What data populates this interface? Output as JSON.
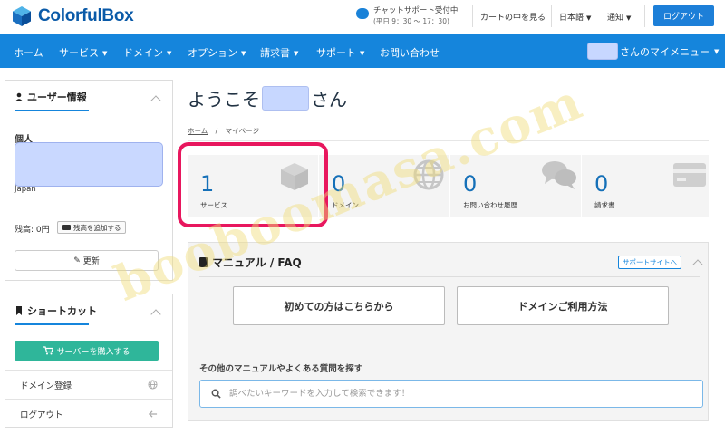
{
  "header": {
    "brand": "ColorfulBox",
    "chat_support": "チャットサポート受付中",
    "chat_hours": "(平日 9：30 ～ 17：30)",
    "cart_link": "カートの中を見る",
    "language": "日本語",
    "notifications": "通知",
    "logout_button": "ログアウト"
  },
  "nav": {
    "items": [
      {
        "label": "ホーム",
        "has_caret": false
      },
      {
        "label": "サービス",
        "has_caret": true
      },
      {
        "label": "ドメイン",
        "has_caret": true
      },
      {
        "label": "オプション",
        "has_caret": true
      },
      {
        "label": "請求書",
        "has_caret": true
      },
      {
        "label": "サポート",
        "has_caret": true
      },
      {
        "label": "お問い合わせ",
        "has_caret": false
      }
    ],
    "my_menu": "さんのマイメニュー"
  },
  "sidebar": {
    "user_info_title": "ユーザー情報",
    "account_type": "個人",
    "country": "Japan",
    "balance_label": "残高: 0円",
    "add_balance_button": "残高を追加する",
    "update_button": "更新",
    "shortcut_title": "ショートカット",
    "buy_server_button": "サーバーを購入する",
    "shortcuts": [
      {
        "label": "ドメイン登録",
        "icon": "globe-icon"
      },
      {
        "label": "ログアウト",
        "icon": "arrow-left-icon"
      }
    ]
  },
  "main": {
    "welcome_prefix": "ようこそ",
    "welcome_suffix": "さん",
    "breadcrumb_home": "ホーム",
    "breadcrumb_sep": "/",
    "breadcrumb_current": "マイページ",
    "stats": [
      {
        "value": "1",
        "label": "サービス",
        "icon": "cube-icon"
      },
      {
        "value": "0",
        "label": "ドメイン",
        "icon": "globe-icon"
      },
      {
        "value": "0",
        "label": "お問い合わせ履歴",
        "icon": "comments-icon"
      },
      {
        "value": "0",
        "label": "請求書",
        "icon": "credit-card-icon"
      }
    ],
    "faq": {
      "title": "マニュアル / FAQ",
      "support_site_link": "サポートサイトへ",
      "beginner_button": "初めての方はこちらから",
      "domain_button": "ドメインご利用方法",
      "search_heading": "その他のマニュアルやよくある質問を探す",
      "search_placeholder": "調べたいキーワードを入力して検索できます！"
    }
  },
  "watermark": "booboomasa.com",
  "colors": {
    "nav_blue": "#1585dc",
    "stat_number": "#1570b8",
    "highlight_border": "#e8175e",
    "buy_button": "#2fb69a",
    "redaction": "#c9d8ff"
  }
}
